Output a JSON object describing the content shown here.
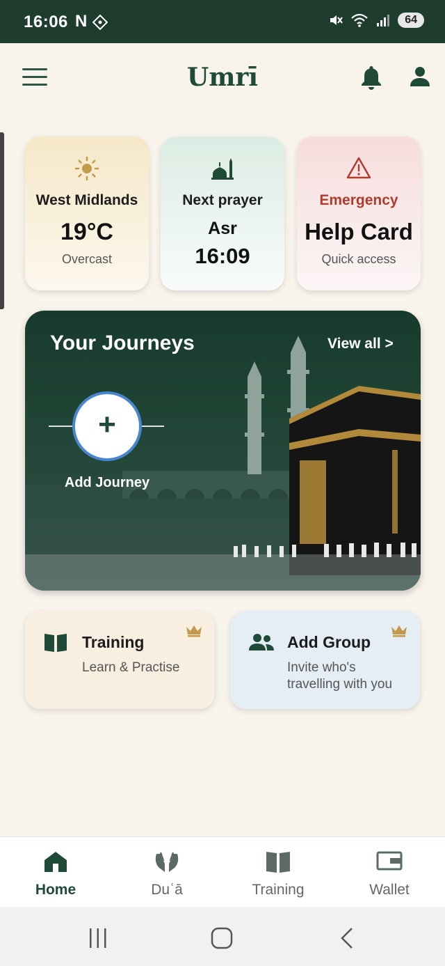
{
  "status_bar": {
    "time": "16:06",
    "notification_letter": "N",
    "battery": "64"
  },
  "header": {
    "title": "Umrī"
  },
  "cards": {
    "weather": {
      "location": "West Midlands",
      "temperature": "19°C",
      "condition": "Overcast"
    },
    "prayer": {
      "label": "Next prayer",
      "name": "Asr",
      "time": "16:09"
    },
    "emergency": {
      "label": "Emergency",
      "title": "Help Card",
      "subtitle": "Quick access"
    }
  },
  "journeys": {
    "title": "Your Journeys",
    "view_all": "View all >",
    "add_label": "Add Journey",
    "add_symbol": "+"
  },
  "features": {
    "training": {
      "title": "Training",
      "subtitle": "Learn & Practise"
    },
    "group": {
      "title": "Add Group",
      "subtitle_line1": "Invite who's",
      "subtitle_line2": "travelling with you"
    }
  },
  "bottom_nav": {
    "items": [
      {
        "label": "Home",
        "icon": "home-icon",
        "active": true
      },
      {
        "label": "Duʿā",
        "icon": "praying-hands-icon",
        "active": false
      },
      {
        "label": "Training",
        "icon": "book-icon",
        "active": false
      },
      {
        "label": "Wallet",
        "icon": "wallet-icon",
        "active": false
      }
    ]
  },
  "colors": {
    "brand_green": "#1f4a37",
    "status_bar": "#1f3d2f",
    "emergency_red": "#b23a2e",
    "gold": "#c39a4c",
    "background": "#f8f4ec"
  }
}
